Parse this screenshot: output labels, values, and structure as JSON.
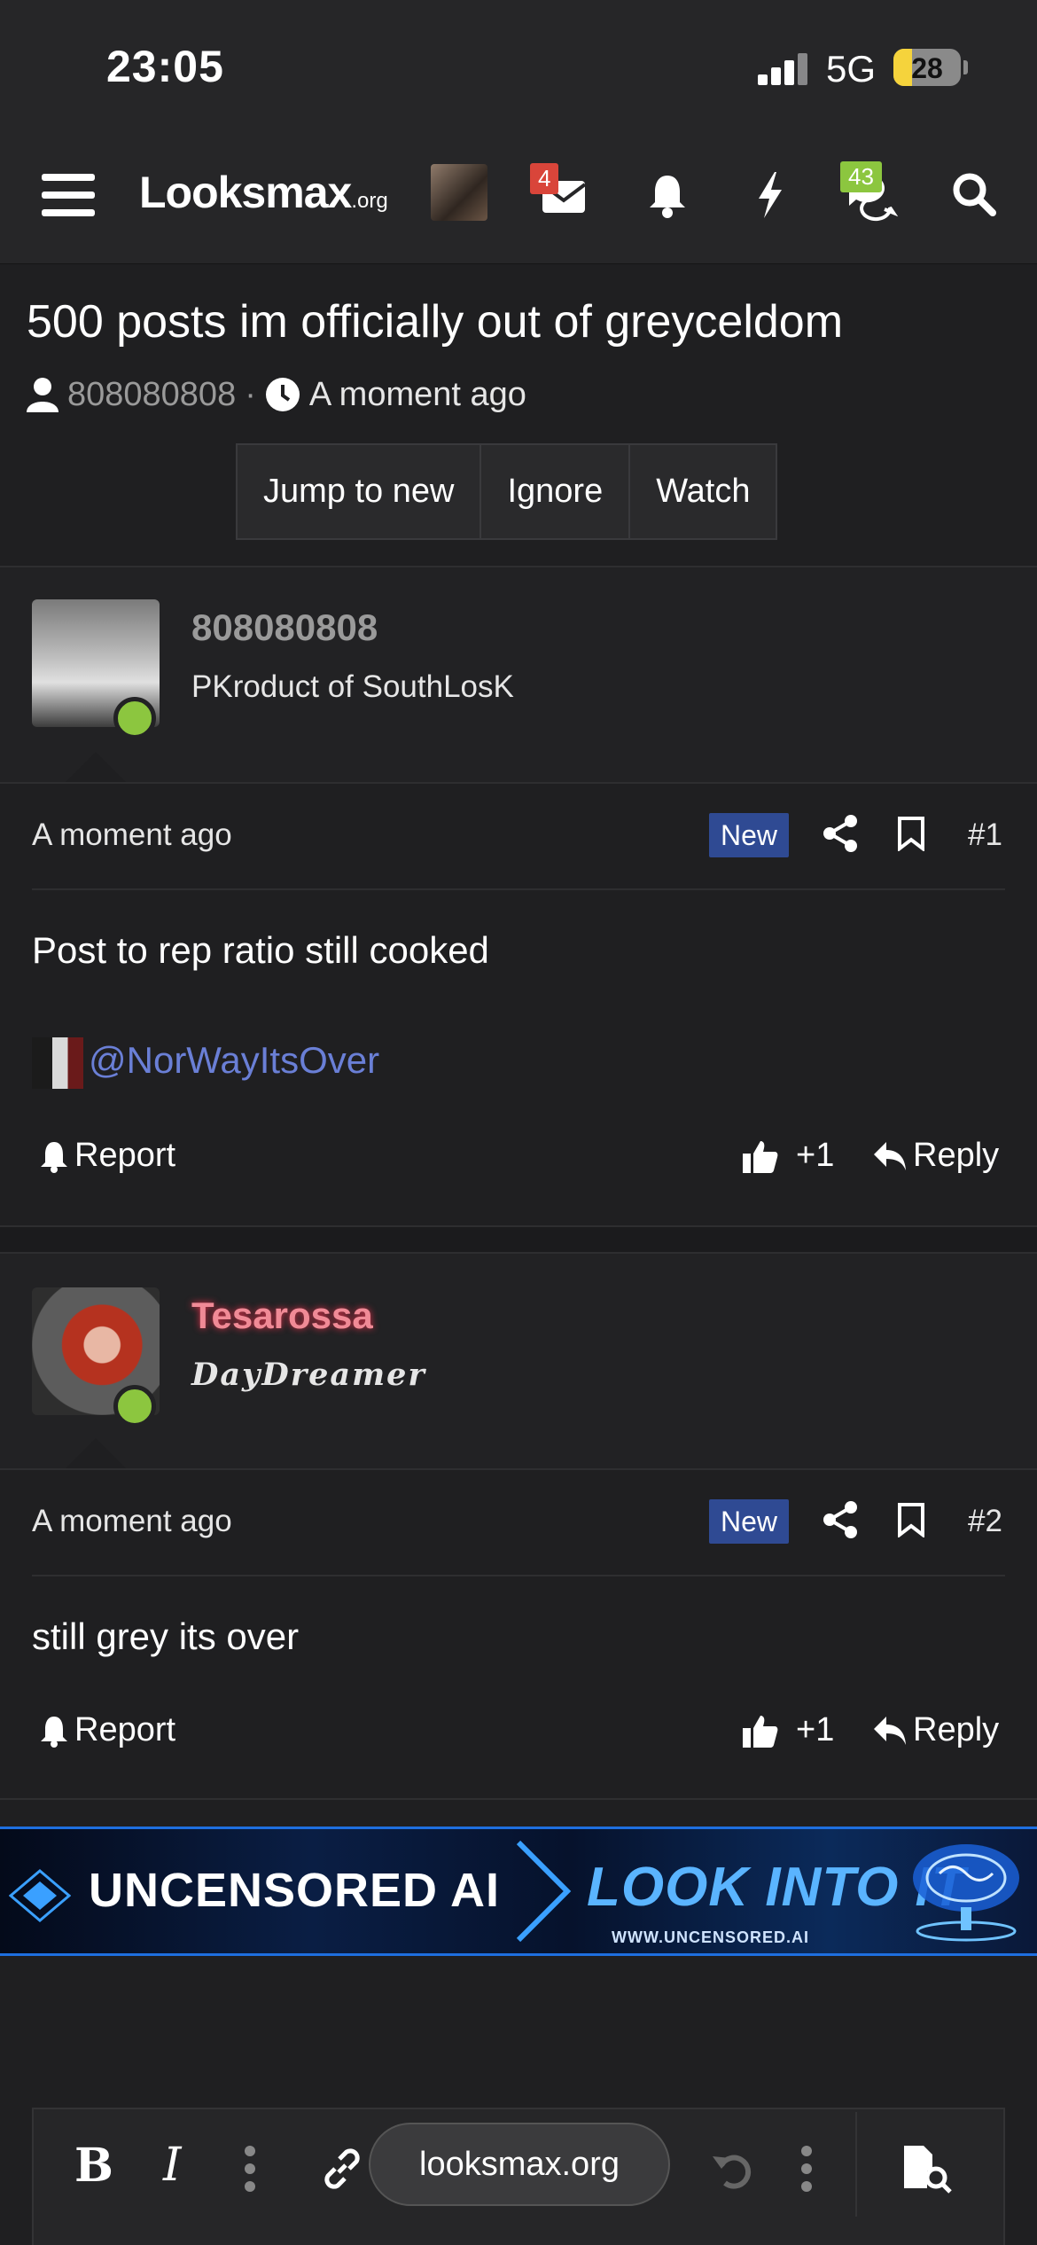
{
  "status_bar": {
    "time": "23:05",
    "network": "5G",
    "battery": "28",
    "battery_level": 0.28
  },
  "nav": {
    "logo_main": "Looksmax",
    "logo_suffix": ".org",
    "inbox_count": "4",
    "alerts_count": "43"
  },
  "thread": {
    "title": "500 posts im officially out of greyceldom",
    "author": "808080808",
    "separator": "·",
    "time": "A moment ago",
    "buttons": [
      "Jump to new",
      "Ignore",
      "Watch"
    ]
  },
  "posts": [
    {
      "username": "808080808",
      "user_title": "PKroduct of SouthLosK",
      "time": "A moment ago",
      "badge": "New",
      "number": "#1",
      "text": "Post to rep ratio still cooked",
      "mention": "@NorWayItsOver",
      "report": "Report",
      "reactions": "+1",
      "reply": "Reply"
    },
    {
      "username": "Tesarossa",
      "user_title": "DayDreamer",
      "time": "A moment ago",
      "badge": "New",
      "number": "#2",
      "text": "still grey its over",
      "report": "Report",
      "reactions": "+1",
      "reply": "Reply"
    }
  ],
  "ad": {
    "left_text": "UNCENSORED AI",
    "right_text": "LOOK INTO IT",
    "url": "WWW.UNCENSORED.AI"
  },
  "editor": {
    "bold": "B",
    "italic": "I"
  },
  "browser": {
    "url": "looksmax.org"
  },
  "colors": {
    "accent": "#2f4a93",
    "online": "#8cc63f",
    "mention": "#6a7fd6",
    "username2": "#f08a96"
  }
}
